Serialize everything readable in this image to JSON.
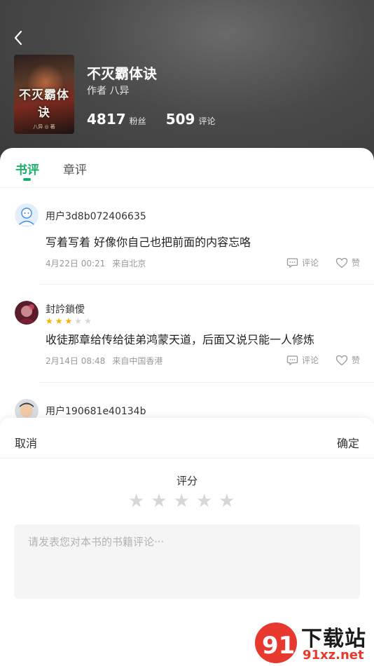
{
  "book": {
    "title": "不灭霸体诀",
    "author_line": "作者 八异",
    "fans_count": "4817",
    "fans_label": "粉丝",
    "comments_count": "509",
    "comments_label": "评论",
    "cover_title": "不灭霸体诀",
    "cover_author": "八异 ◎ 著"
  },
  "tabs": [
    {
      "label": "书评"
    },
    {
      "label": "章评"
    }
  ],
  "reviews": [
    {
      "username": "用户3d8b072406635",
      "stars": 0,
      "content": "写着写着 好像你自己也把前面的内容忘咯",
      "date": "4月22日 00:21",
      "location": "来自北京",
      "comment_label": "评论",
      "like_label": "赞"
    },
    {
      "username": "封訡鎖僾",
      "stars": 3,
      "stars_total": 5,
      "content": "收徒那章给传给徒弟鸿蒙天道，后面又说只能一人修炼",
      "date": "2月14日 08:48",
      "location": "来自中国香港",
      "comment_label": "评论",
      "like_label": "赞"
    },
    {
      "username": "用户190681e40134b"
    }
  ],
  "sheet": {
    "cancel_label": "取消",
    "confirm_label": "确定",
    "rating_label": "评分",
    "rating_value": 0,
    "rating_max": 5,
    "comment_placeholder": "请发表您对本书的书籍评论···"
  },
  "watermark": {
    "big_text": "下载站",
    "url_text": "91xz.net"
  },
  "colors": {
    "accent": "#18b06b",
    "star_filled": "#f5b200",
    "star_empty": "#d7d7d7",
    "watermark_red": "#e8392e"
  }
}
